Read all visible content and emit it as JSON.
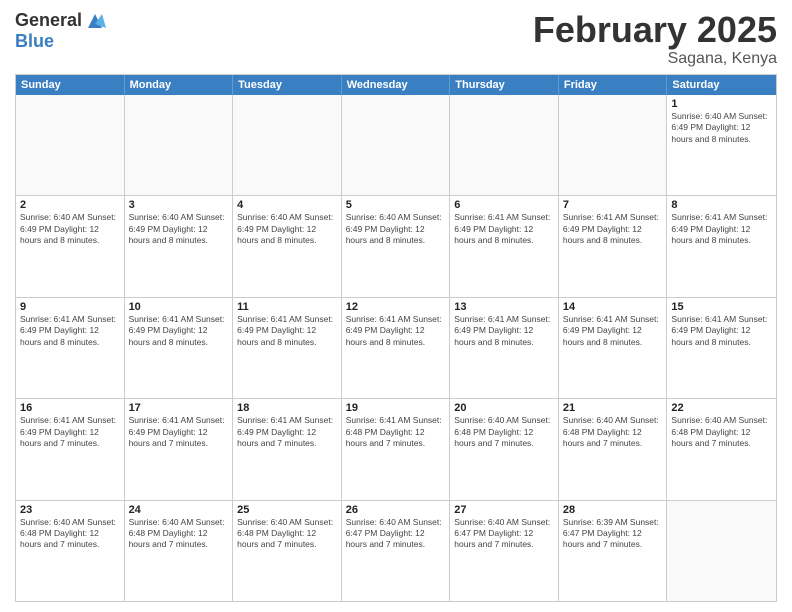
{
  "logo": {
    "general": "General",
    "blue": "Blue"
  },
  "title": "February 2025",
  "location": "Sagana, Kenya",
  "dayHeaders": [
    "Sunday",
    "Monday",
    "Tuesday",
    "Wednesday",
    "Thursday",
    "Friday",
    "Saturday"
  ],
  "weeks": [
    [
      {
        "day": "",
        "info": ""
      },
      {
        "day": "",
        "info": ""
      },
      {
        "day": "",
        "info": ""
      },
      {
        "day": "",
        "info": ""
      },
      {
        "day": "",
        "info": ""
      },
      {
        "day": "",
        "info": ""
      },
      {
        "day": "1",
        "info": "Sunrise: 6:40 AM\nSunset: 6:49 PM\nDaylight: 12 hours and 8 minutes."
      }
    ],
    [
      {
        "day": "2",
        "info": "Sunrise: 6:40 AM\nSunset: 6:49 PM\nDaylight: 12 hours and 8 minutes."
      },
      {
        "day": "3",
        "info": "Sunrise: 6:40 AM\nSunset: 6:49 PM\nDaylight: 12 hours and 8 minutes."
      },
      {
        "day": "4",
        "info": "Sunrise: 6:40 AM\nSunset: 6:49 PM\nDaylight: 12 hours and 8 minutes."
      },
      {
        "day": "5",
        "info": "Sunrise: 6:40 AM\nSunset: 6:49 PM\nDaylight: 12 hours and 8 minutes."
      },
      {
        "day": "6",
        "info": "Sunrise: 6:41 AM\nSunset: 6:49 PM\nDaylight: 12 hours and 8 minutes."
      },
      {
        "day": "7",
        "info": "Sunrise: 6:41 AM\nSunset: 6:49 PM\nDaylight: 12 hours and 8 minutes."
      },
      {
        "day": "8",
        "info": "Sunrise: 6:41 AM\nSunset: 6:49 PM\nDaylight: 12 hours and 8 minutes."
      }
    ],
    [
      {
        "day": "9",
        "info": "Sunrise: 6:41 AM\nSunset: 6:49 PM\nDaylight: 12 hours and 8 minutes."
      },
      {
        "day": "10",
        "info": "Sunrise: 6:41 AM\nSunset: 6:49 PM\nDaylight: 12 hours and 8 minutes."
      },
      {
        "day": "11",
        "info": "Sunrise: 6:41 AM\nSunset: 6:49 PM\nDaylight: 12 hours and 8 minutes."
      },
      {
        "day": "12",
        "info": "Sunrise: 6:41 AM\nSunset: 6:49 PM\nDaylight: 12 hours and 8 minutes."
      },
      {
        "day": "13",
        "info": "Sunrise: 6:41 AM\nSunset: 6:49 PM\nDaylight: 12 hours and 8 minutes."
      },
      {
        "day": "14",
        "info": "Sunrise: 6:41 AM\nSunset: 6:49 PM\nDaylight: 12 hours and 8 minutes."
      },
      {
        "day": "15",
        "info": "Sunrise: 6:41 AM\nSunset: 6:49 PM\nDaylight: 12 hours and 8 minutes."
      }
    ],
    [
      {
        "day": "16",
        "info": "Sunrise: 6:41 AM\nSunset: 6:49 PM\nDaylight: 12 hours and 7 minutes."
      },
      {
        "day": "17",
        "info": "Sunrise: 6:41 AM\nSunset: 6:49 PM\nDaylight: 12 hours and 7 minutes."
      },
      {
        "day": "18",
        "info": "Sunrise: 6:41 AM\nSunset: 6:49 PM\nDaylight: 12 hours and 7 minutes."
      },
      {
        "day": "19",
        "info": "Sunrise: 6:41 AM\nSunset: 6:48 PM\nDaylight: 12 hours and 7 minutes."
      },
      {
        "day": "20",
        "info": "Sunrise: 6:40 AM\nSunset: 6:48 PM\nDaylight: 12 hours and 7 minutes."
      },
      {
        "day": "21",
        "info": "Sunrise: 6:40 AM\nSunset: 6:48 PM\nDaylight: 12 hours and 7 minutes."
      },
      {
        "day": "22",
        "info": "Sunrise: 6:40 AM\nSunset: 6:48 PM\nDaylight: 12 hours and 7 minutes."
      }
    ],
    [
      {
        "day": "23",
        "info": "Sunrise: 6:40 AM\nSunset: 6:48 PM\nDaylight: 12 hours and 7 minutes."
      },
      {
        "day": "24",
        "info": "Sunrise: 6:40 AM\nSunset: 6:48 PM\nDaylight: 12 hours and 7 minutes."
      },
      {
        "day": "25",
        "info": "Sunrise: 6:40 AM\nSunset: 6:48 PM\nDaylight: 12 hours and 7 minutes."
      },
      {
        "day": "26",
        "info": "Sunrise: 6:40 AM\nSunset: 6:47 PM\nDaylight: 12 hours and 7 minutes."
      },
      {
        "day": "27",
        "info": "Sunrise: 6:40 AM\nSunset: 6:47 PM\nDaylight: 12 hours and 7 minutes."
      },
      {
        "day": "28",
        "info": "Sunrise: 6:39 AM\nSunset: 6:47 PM\nDaylight: 12 hours and 7 minutes."
      },
      {
        "day": "",
        "info": ""
      }
    ]
  ]
}
